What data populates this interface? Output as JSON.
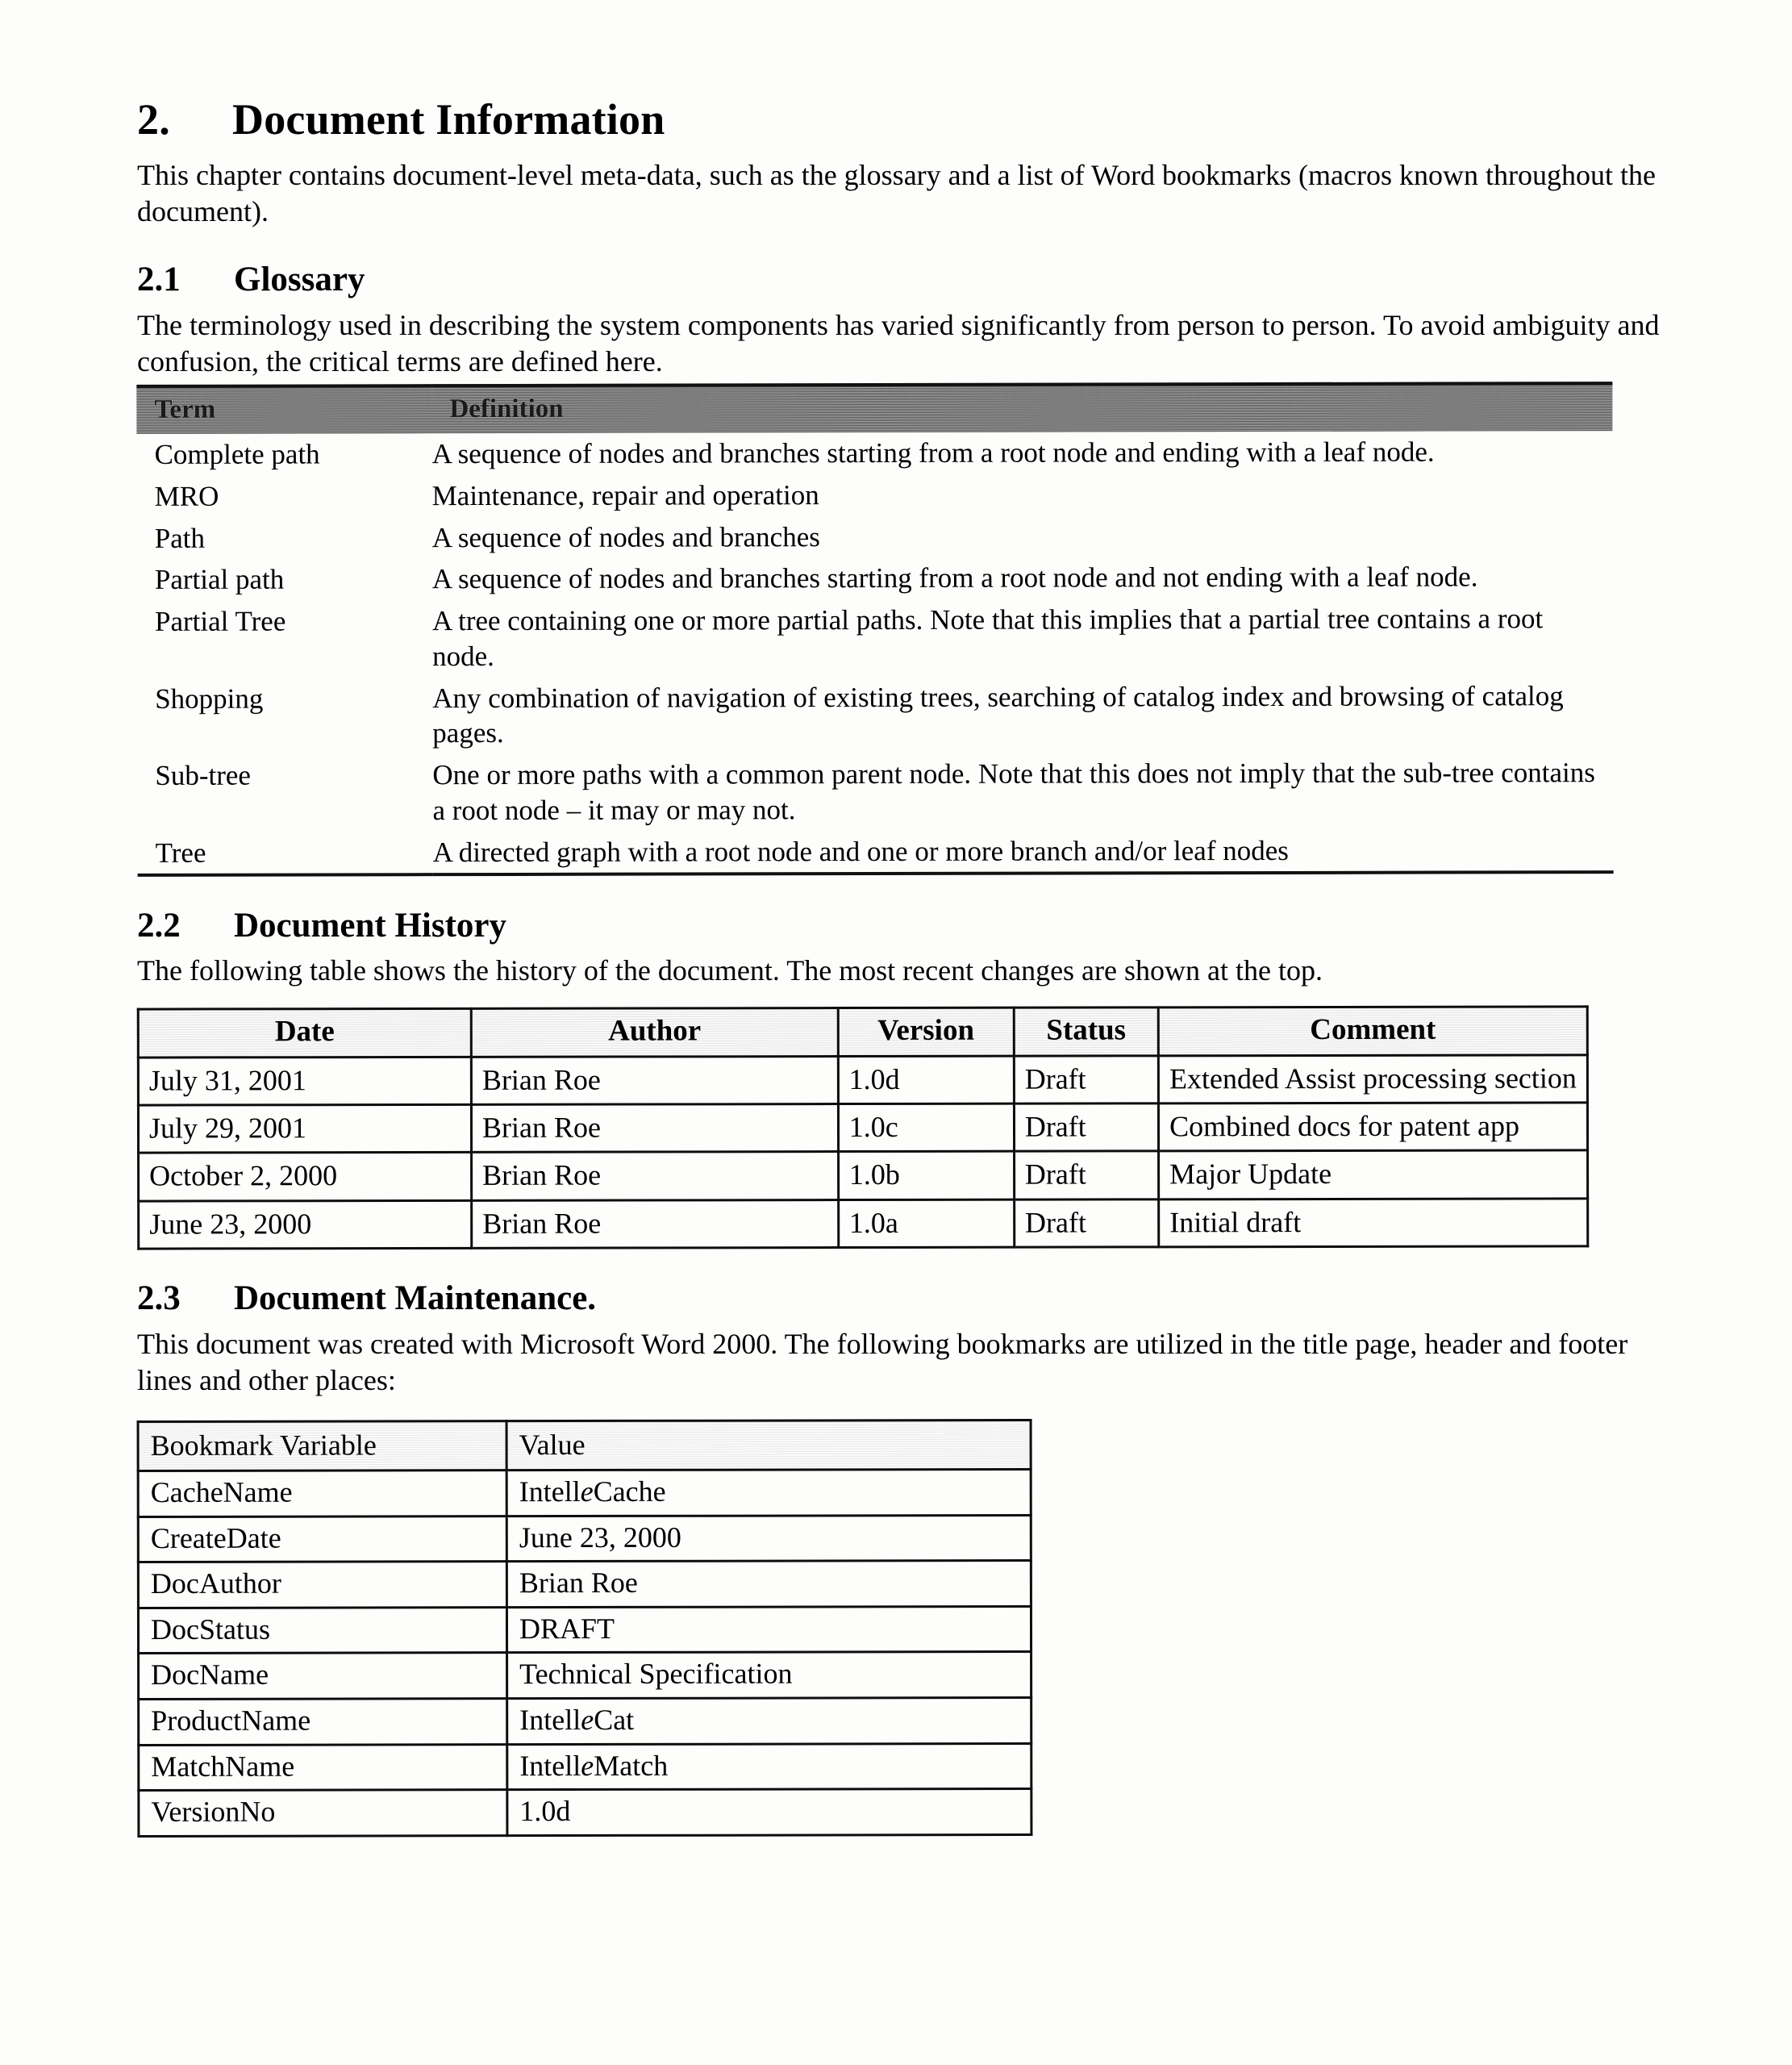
{
  "chapter": {
    "number": "2.",
    "title": "Document Information",
    "intro": "This chapter contains document-level meta-data, such as the glossary and a list of Word bookmarks (macros known throughout the document)."
  },
  "glossary_section": {
    "number": "2.1",
    "title": "Glossary",
    "intro": "The terminology used in describing the system components has varied significantly from person to person.  To avoid ambiguity and confusion, the critical terms are defined here.",
    "table": {
      "headers": [
        "Term",
        "Definition"
      ],
      "rows": [
        {
          "term": "Complete path",
          "definition": "A sequence of nodes and branches starting from a root node and ending with a leaf node."
        },
        {
          "term": "MRO",
          "definition": "Maintenance, repair and operation"
        },
        {
          "term": "Path",
          "definition": "A sequence of nodes and branches"
        },
        {
          "term": "Partial path",
          "definition": "A sequence of nodes and branches starting from a root node and not ending with a leaf node."
        },
        {
          "term": "Partial Tree",
          "definition": "A tree containing one or more partial paths.  Note that this implies that a partial tree contains a root node."
        },
        {
          "term": "Shopping",
          "definition": "Any combination of navigation of existing trees, searching of catalog index and browsing of catalog pages."
        },
        {
          "term": "Sub-tree",
          "definition": "One or more paths with a common parent node.  Note that this does not imply that the sub-tree contains a root node – it may or may not."
        },
        {
          "term": "Tree",
          "definition": "A directed graph with a root node and one or more branch and/or leaf nodes"
        }
      ]
    }
  },
  "history_section": {
    "number": "2.2",
    "title": "Document History",
    "intro": "The following table shows the history of the document.  The most recent changes are shown at the top.",
    "table": {
      "headers": [
        "Date",
        "Author",
        "Version",
        "Status",
        "Comment"
      ],
      "rows": [
        {
          "date": "July 31, 2001",
          "author": "Brian Roe",
          "version": "1.0d",
          "status": "Draft",
          "comment": "Extended Assist processing section"
        },
        {
          "date": "July 29, 2001",
          "author": "Brian Roe",
          "version": "1.0c",
          "status": "Draft",
          "comment": "Combined docs for patent app"
        },
        {
          "date": "October 2, 2000",
          "author": "Brian Roe",
          "version": "1.0b",
          "status": "Draft",
          "comment": "Major Update"
        },
        {
          "date": "June 23, 2000",
          "author": "Brian Roe",
          "version": "1.0a",
          "status": "Draft",
          "comment": "Initial draft"
        }
      ]
    }
  },
  "maintenance_section": {
    "number": "2.3",
    "title": "Document Maintenance.",
    "intro": "This document was created with Microsoft Word 2000. The following bookmarks are utilized in the title page, header and footer lines and other places:",
    "table": {
      "headers": [
        "Bookmark Variable",
        "Value"
      ],
      "rows": [
        {
          "variable": "CacheName",
          "value": "IntelleCache"
        },
        {
          "variable": "CreateDate",
          "value": "June 23, 2000"
        },
        {
          "variable": "DocAuthor",
          "value": "Brian Roe"
        },
        {
          "variable": "DocStatus",
          "value": "DRAFT"
        },
        {
          "variable": "DocName",
          "value": "Technical Specification"
        },
        {
          "variable": "ProductName",
          "value": "IntelleCat"
        },
        {
          "variable": "MatchName",
          "value": "IntelleMatch"
        },
        {
          "variable": "VersionNo",
          "value": "1.0d"
        }
      ]
    }
  },
  "colors": {
    "page_background": "#fdfdfc",
    "text": "#000000",
    "glossary_header_fill": "#8e8e8e",
    "table_border": "#0d0d0d"
  }
}
